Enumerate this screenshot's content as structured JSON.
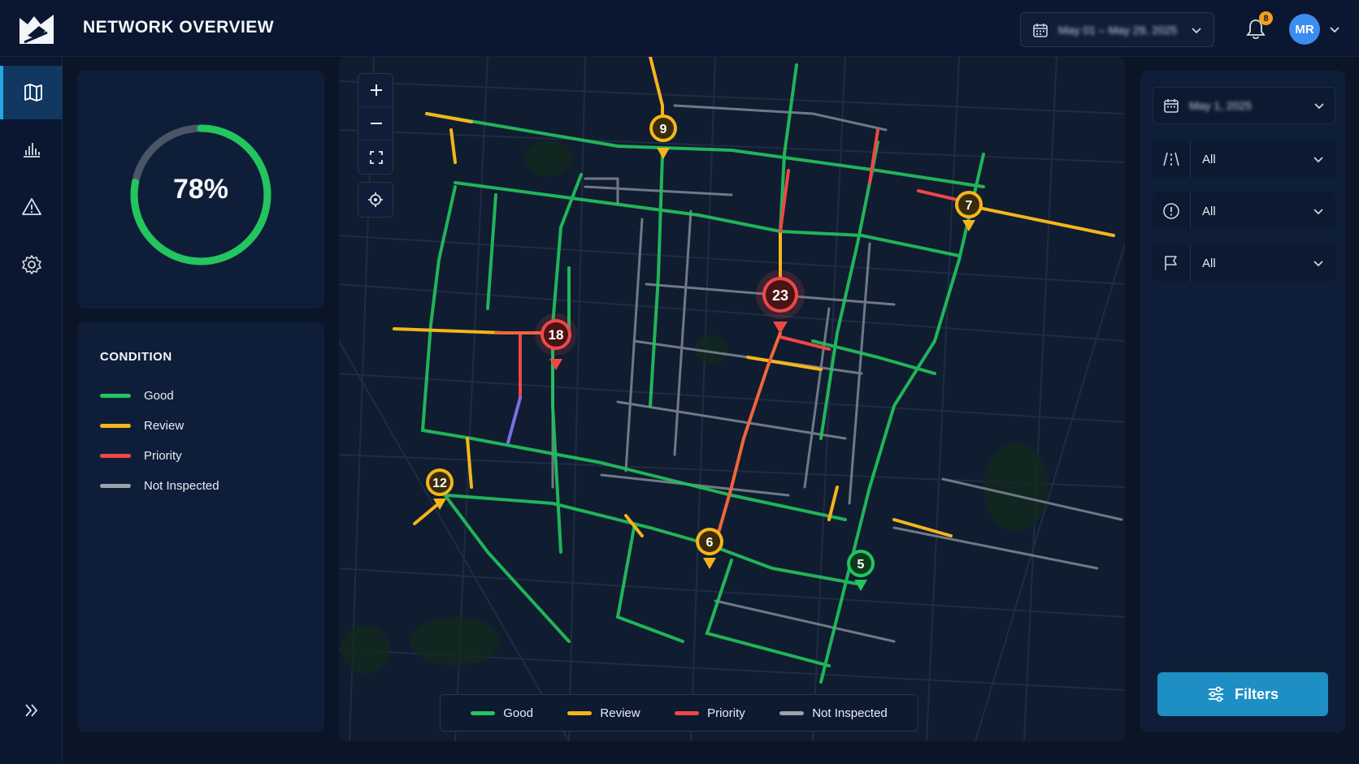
{
  "header": {
    "title": "NETWORK OVERVIEW",
    "date_range": "May 01 – May 29, 2025",
    "notification_count": "8",
    "user_initials": "MR"
  },
  "nav": {
    "items": [
      {
        "name": "map",
        "icon": "map-icon",
        "active": true
      },
      {
        "name": "analytics",
        "icon": "bar-chart-icon",
        "active": false
      },
      {
        "name": "alerts",
        "icon": "warning-icon",
        "active": false
      },
      {
        "name": "settings",
        "icon": "gear-icon",
        "active": false
      }
    ],
    "expand_icon": "double-chevron-right-icon"
  },
  "gauge": {
    "label": "78%",
    "value_percent": 78,
    "color": "#22c55e",
    "track_color": "#4a5568"
  },
  "condition_legend": {
    "title": "CONDITION",
    "items": [
      {
        "label": "Good",
        "color": "#22c55e"
      },
      {
        "label": "Review",
        "color": "#f5b51a"
      },
      {
        "label": "Priority",
        "color": "#f04747"
      },
      {
        "label": "Not Inspected",
        "color": "#9aa3ad"
      }
    ]
  },
  "map": {
    "markers": [
      {
        "label": "9",
        "status": "review"
      },
      {
        "label": "7",
        "status": "review"
      },
      {
        "label": "23",
        "status": "priority"
      },
      {
        "label": "18",
        "status": "priority"
      },
      {
        "label": "12",
        "status": "review"
      },
      {
        "label": "6",
        "status": "review"
      },
      {
        "label": "5",
        "status": "good"
      }
    ],
    "legend": [
      "Good",
      "Review",
      "Priority",
      "Not Inspected"
    ]
  },
  "filters": {
    "date": "May 1, 2025",
    "road_type": "All",
    "severity": "All",
    "flag": "All",
    "button_label": "Filters"
  },
  "colors": {
    "good": "#22c55e",
    "review": "#f5b51a",
    "priority": "#f04747",
    "not_inspected": "#9aa3ad",
    "accent": "#1d8fc4"
  }
}
